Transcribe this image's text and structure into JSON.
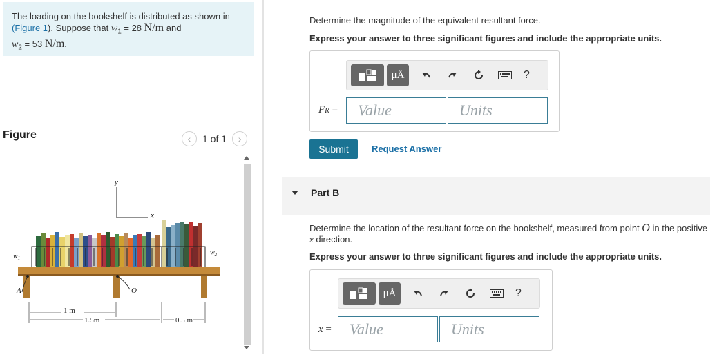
{
  "problem": {
    "text_before_link": "The loading on the bookshelf is distributed as shown in",
    "link_open": "(",
    "link": "Figure 1",
    "text_after_link": "). Suppose that",
    "w1_symbol": "w",
    "w1_sub": "1",
    "w1_value": " = 28",
    "unit1": "N/m",
    "and": "and",
    "w2_symbol": "w",
    "w2_sub": "2",
    "w2_value": " = 53",
    "unit2": "N/m",
    "period": "."
  },
  "figure": {
    "label": "Figure",
    "pager": "1 of 1",
    "labels": {
      "y": "y",
      "x": "x",
      "w1": "w",
      "w1_sub": "1",
      "w2": "w",
      "w2_sub": "2",
      "A": "A",
      "O": "O",
      "dim_1m": "1 m",
      "dim_15m": "1.5m",
      "dim_05m": "0.5 m"
    }
  },
  "partA": {
    "question": "Determine the magnitude of the equivalent resultant force.",
    "instruction": "Express your answer to three significant figures and include the appropriate units.",
    "mu_label": "μÅ",
    "help": "?",
    "var_label": "F",
    "var_sub": "R",
    "eq": " =",
    "value_placeholder": "Value",
    "units_placeholder": "Units",
    "submit": "Submit",
    "request": "Request Answer"
  },
  "partB": {
    "title": "Part B",
    "question_line1_a": "Determine the location of the resultant force on the bookshelf, measured from point",
    "point": "O",
    "question_line1_b": "in the positive",
    "question_line2_var": "x",
    "question_line2": " direction.",
    "instruction": "Express your answer to three significant figures and include the appropriate units.",
    "mu_label": "μÅ",
    "help": "?",
    "var_label": "x",
    "eq": " =",
    "value_placeholder": "Value",
    "units_placeholder": "Units"
  }
}
